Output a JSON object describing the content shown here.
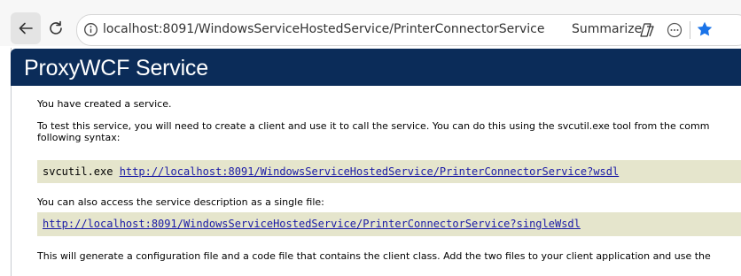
{
  "browser": {
    "url": "localhost:8091/WindowsServiceHostedService/PrinterConnectorService",
    "summarize_label": "Summarize"
  },
  "page": {
    "title": "ProxyWCF Service",
    "intro": "You have created a service.",
    "test_line1": "To test this service, you will need to create a client and use it to call the service. You can do this using the svcutil.exe tool from the comm",
    "test_line2": "following syntax:",
    "cmd_prefix": "svcutil.exe ",
    "wsdl_link": "http://localhost:8091/WindowsServiceHostedService/PrinterConnectorService?wsdl",
    "single_file_text": "You can also access the service description as a single file:",
    "single_wsdl_link": "http://localhost:8091/WindowsServiceHostedService/PrinterConnectorService?singleWsdl",
    "generate_text": "This will generate a configuration file and a code file that contains the client class. Add the two files to your client application and use the"
  },
  "colors": {
    "banner": "#0b2c59",
    "code_background": "#e5e5cc",
    "link": "#1a1aa6",
    "favorite_star": "#1a73e8"
  }
}
